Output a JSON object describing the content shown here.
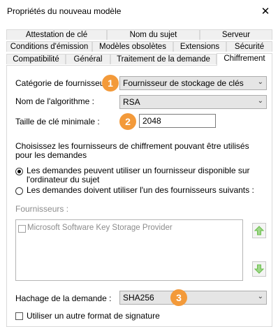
{
  "window": {
    "title": "Propriétés du nouveau modèle",
    "close_glyph": "✕"
  },
  "tabs": {
    "row1": [
      "Attestation de clé",
      "Nom du sujet",
      "Serveur"
    ],
    "row2": [
      "Conditions d'émission",
      "Modèles obsolètes",
      "Extensions",
      "Sécurité"
    ],
    "row3": [
      "Compatibilité",
      "Général",
      "Traitement de la demande",
      "Chiffrement"
    ],
    "active": "Chiffrement"
  },
  "form": {
    "provider_category_label": "Catégorie de fournisseur :",
    "provider_category_value": "Fournisseur de stockage de clés",
    "algorithm_label": "Nom de l'algorithme :",
    "algorithm_value": "RSA",
    "min_key_label": "Taille de clé minimale :",
    "min_key_value": "2048",
    "choose_text_line1": "Choisissez les fournisseurs de chiffrement pouvant être utilisés",
    "choose_text_line2": "pour les demandes",
    "radio1_line1": "Les demandes peuvent utiliser un fournisseur disponible sur",
    "radio1_line2": "l'ordinateur du sujet",
    "radio2": "Les demandes doivent utiliser l'un des fournisseurs suivants :",
    "providers_label": "Fournisseurs :",
    "provider_item": "Microsoft Software Key Storage Provider",
    "hash_label": "Hachage de la demande :",
    "hash_value": "SHA256",
    "alt_format_label": "Utiliser un autre format de signature"
  },
  "badges": [
    "1",
    "2",
    "3"
  ],
  "colors": {
    "badge": "#f39a3a",
    "arrow_green": "#6abf4b"
  }
}
